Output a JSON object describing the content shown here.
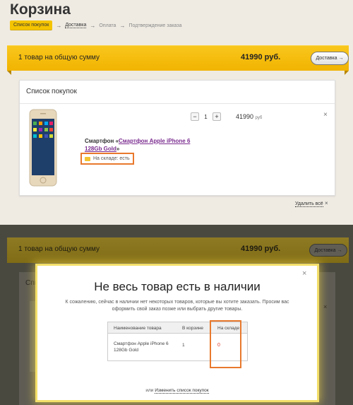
{
  "header": {
    "title": "Корзина"
  },
  "steps": [
    {
      "label": "Список покупок"
    },
    {
      "label": "Доставка"
    },
    {
      "label": "Оплата"
    },
    {
      "label": "Подтверждение заказа"
    }
  ],
  "step_arrow": "→",
  "summary": {
    "text": "1 товар на общую сумму",
    "price": "41990 руб.",
    "button": "Доставка →"
  },
  "card": {
    "title": "Список покупок",
    "product": {
      "prefix": "Смартфон «",
      "name": "Смартфон Apple iPhone 6 128Gb Gold",
      "suffix": "»",
      "stock": "На складе: есть",
      "qty_minus": "−",
      "qty": "1",
      "qty_plus": "+",
      "price": "41990",
      "currency": "руб",
      "remove": "×"
    },
    "delete_all": "Удалить всё",
    "delete_all_x": "×"
  },
  "modal": {
    "close": "×",
    "title": "Не весь товар есть в наличии",
    "description": "К сожалению, сейчас в наличии нет некоторых товаров, которые вы хотите заказать. Просим вас оформить свой заказ позже или выбрать другие товары.",
    "table": {
      "headers": [
        "Наименование товара",
        "В корзине",
        "На складе"
      ],
      "row": [
        "Смартфон Apple iPhone 6 128Gb Gold",
        "1",
        "0"
      ]
    },
    "footer_prefix": "или",
    "footer_link": "Изменить список покупок"
  },
  "colors": {
    "accent": "#f5c400",
    "highlight": "#e8792d",
    "link": "#7a2b8f",
    "out_of_stock": "#e03c28"
  }
}
